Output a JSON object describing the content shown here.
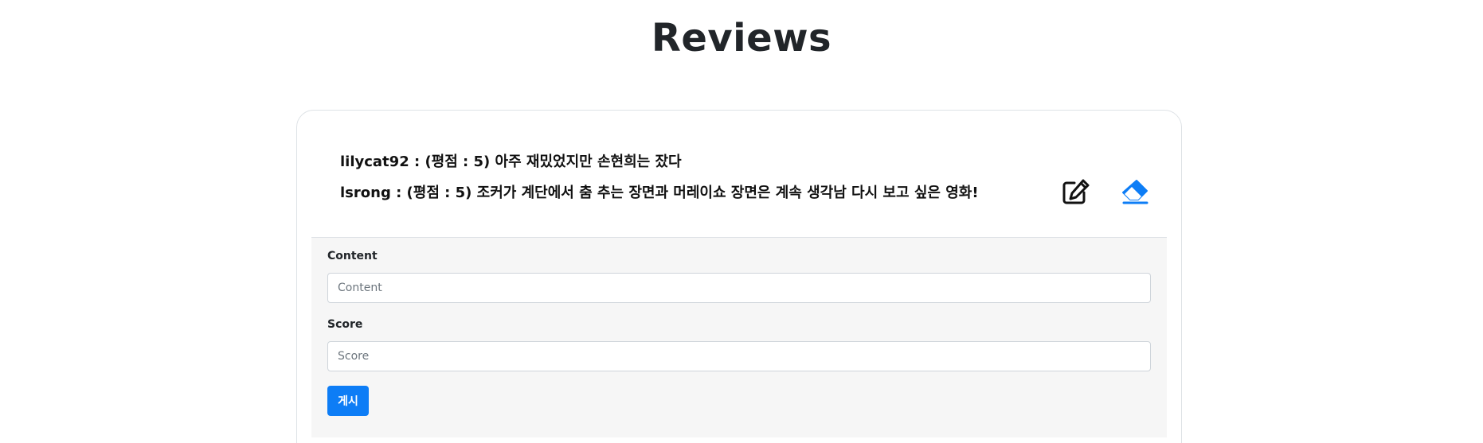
{
  "page": {
    "title": "Reviews"
  },
  "reviews": [
    "lilycat92 : (평점 : 5) 아주 재밌었지만 손현희는 잤다",
    "lsrong : (평점 : 5) 조커가 계단에서 춤 추는 장면과 머레이쇼 장면은 계속 생각남 다시 보고 싶은 영화!"
  ],
  "actions": {
    "edit_icon": "edit-icon",
    "erase_icon": "eraser-icon",
    "erase_color": "#0d7df6"
  },
  "form": {
    "content_label": "Content",
    "content_placeholder": "Content",
    "score_label": "Score",
    "score_placeholder": "Score",
    "submit_label": "게시",
    "submit_color": "#0d7df6"
  }
}
